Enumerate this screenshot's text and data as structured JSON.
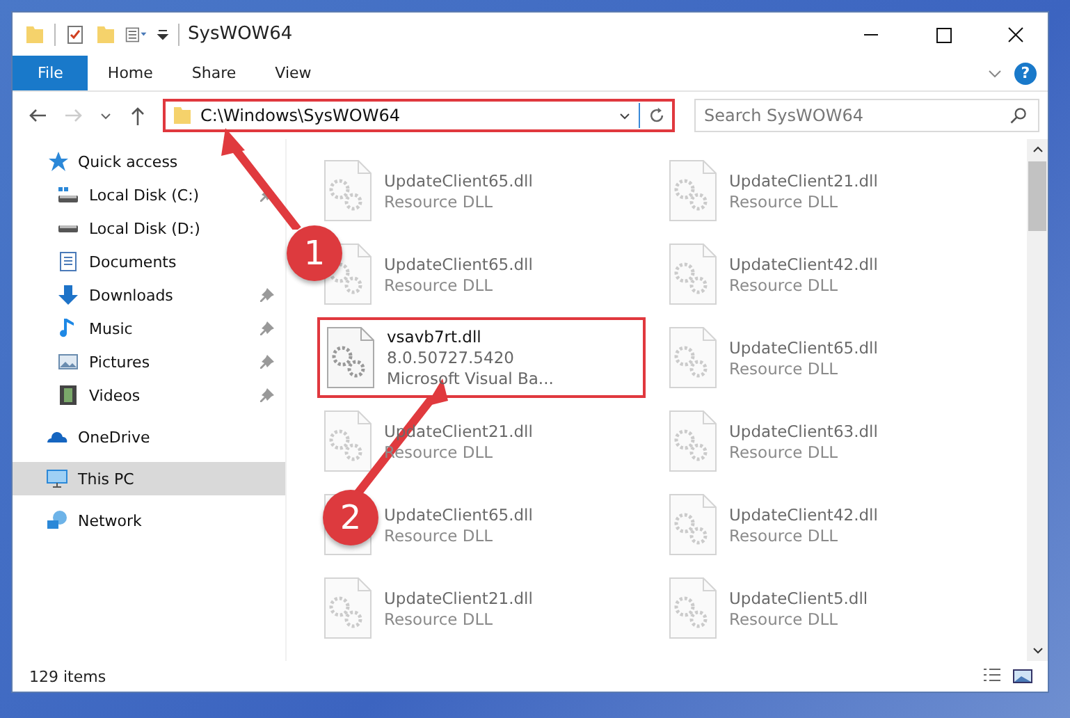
{
  "window": {
    "title": "SysWOW64"
  },
  "ribbon": {
    "tabs": [
      {
        "label": "File",
        "selected": true
      },
      {
        "label": "Home",
        "selected": false
      },
      {
        "label": "Share",
        "selected": false
      },
      {
        "label": "View",
        "selected": false
      }
    ],
    "help": "?"
  },
  "nav": {
    "forward_disabled": true,
    "address": {
      "value": "C:\\Windows\\SysWOW64",
      "highlighted": true
    },
    "search": {
      "placeholder": "Search SysWOW64"
    }
  },
  "sidebar": {
    "items": [
      {
        "label": "Quick access",
        "kind": "star",
        "selected": false,
        "children": [
          {
            "label": "Local Disk (C:)",
            "kind": "system-drive",
            "pinned": true,
            "selected": false
          },
          {
            "label": "Local Disk (D:)",
            "kind": "drive",
            "pinned": false,
            "selected": false
          },
          {
            "label": "Documents",
            "kind": "documents",
            "selected": false
          },
          {
            "label": "Downloads",
            "kind": "downloads",
            "pinned": true,
            "selected": false
          },
          {
            "label": "Music",
            "kind": "music",
            "pinned": true,
            "selected": false
          },
          {
            "label": "Pictures",
            "kind": "pictures",
            "pinned": true,
            "selected": false
          },
          {
            "label": "Videos",
            "kind": "videos",
            "pinned": true,
            "selected": false
          }
        ]
      },
      {
        "label": "OneDrive",
        "kind": "cloud",
        "selected": false
      },
      {
        "label": "This PC",
        "kind": "computer",
        "selected": true
      },
      {
        "label": "Network",
        "kind": "network",
        "selected": false
      }
    ]
  },
  "files": [
    {
      "name": "UpdateClient65.dll",
      "details": [
        "Resource DLL"
      ],
      "faded": true,
      "highlighted": false
    },
    {
      "name": "UpdateClient21.dll",
      "details": [
        "Resource DLL"
      ],
      "faded": true,
      "highlighted": false
    },
    {
      "name": "UpdateClient65.dll",
      "details": [
        "Resource DLL"
      ],
      "faded": true,
      "highlighted": false
    },
    {
      "name": "UpdateClient42.dll",
      "details": [
        "Resource DLL"
      ],
      "faded": true,
      "highlighted": false
    },
    {
      "name": "vsavb7rt.dll",
      "details": [
        "8.0.50727.5420",
        "Microsoft Visual Ba..."
      ],
      "faded": false,
      "highlighted": true
    },
    {
      "name": "UpdateClient65.dll",
      "details": [
        "Resource DLL"
      ],
      "faded": true,
      "highlighted": false
    },
    {
      "name": "UpdateClient21.dll",
      "details": [
        "Resource DLL"
      ],
      "faded": true,
      "highlighted": false
    },
    {
      "name": "UpdateClient63.dll",
      "details": [
        "Resource DLL"
      ],
      "faded": true,
      "highlighted": false
    },
    {
      "name": "UpdateClient65.dll",
      "details": [
        "Resource DLL"
      ],
      "faded": true,
      "highlighted": false
    },
    {
      "name": "UpdateClient42.dll",
      "details": [
        "Resource DLL"
      ],
      "faded": true,
      "highlighted": false
    },
    {
      "name": "UpdateClient21.dll",
      "details": [
        "Resource DLL"
      ],
      "faded": true,
      "highlighted": false
    },
    {
      "name": "UpdateClient5.dll",
      "details": [
        "Resource DLL"
      ],
      "faded": true,
      "highlighted": false
    }
  ],
  "status_bar": {
    "text": "129 items"
  },
  "annotations": [
    {
      "label": "1"
    },
    {
      "label": "2"
    }
  ]
}
